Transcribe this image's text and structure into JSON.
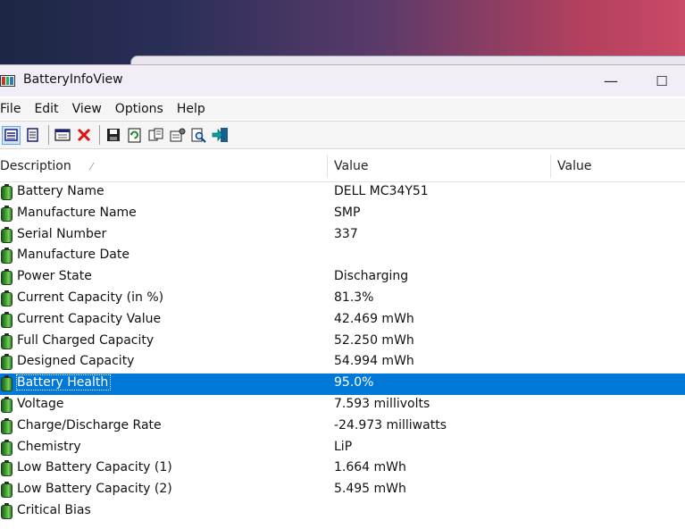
{
  "window": {
    "title": "BatteryInfoView",
    "minimize_glyph": "—",
    "maximize_glyph": "☐"
  },
  "menu": [
    "File",
    "Edit",
    "View",
    "Options",
    "Help"
  ],
  "toolbar": {
    "buttons": [
      "view-mode-icon",
      "list-mode-icon",
      "properties-window-icon",
      "delete-icon",
      "save-icon",
      "refresh-icon",
      "copy-icon",
      "properties-icon",
      "find-icon",
      "exit-icon"
    ]
  },
  "table": {
    "columns": [
      "Description",
      "Value",
      "Value"
    ],
    "sort_indicator": "⁄",
    "rows": [
      {
        "description": "Battery Name",
        "value": "DELL MC34Y51"
      },
      {
        "description": "Manufacture Name",
        "value": "SMP"
      },
      {
        "description": "Serial Number",
        "value": "337"
      },
      {
        "description": "Manufacture Date",
        "value": ""
      },
      {
        "description": "Power State",
        "value": "Discharging"
      },
      {
        "description": "Current Capacity (in %)",
        "value": "81.3%"
      },
      {
        "description": "Current Capacity Value",
        "value": "42.469 mWh"
      },
      {
        "description": "Full Charged Capacity",
        "value": "52.250 mWh"
      },
      {
        "description": "Designed Capacity",
        "value": "54.994 mWh"
      },
      {
        "description": "Battery Health",
        "value": "95.0%"
      },
      {
        "description": "Voltage",
        "value": "7.593 millivolts"
      },
      {
        "description": "Charge/Discharge Rate",
        "value": "-24.973 milliwatts"
      },
      {
        "description": "Chemistry",
        "value": "LiP"
      },
      {
        "description": "Low Battery Capacity (1)",
        "value": "1.664 mWh"
      },
      {
        "description": "Low Battery Capacity (2)",
        "value": "5.495 mWh"
      },
      {
        "description": "Critical Bias",
        "value": ""
      }
    ],
    "selected_row": 9
  },
  "colors": {
    "selection": "#0078d7",
    "battery_icon": "#3f9d33"
  }
}
